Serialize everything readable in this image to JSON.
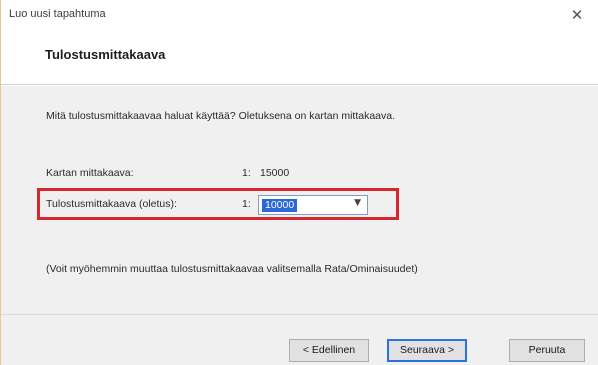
{
  "window": {
    "title": "Luo uusi tapahtuma",
    "close_glyph": "✕"
  },
  "header": {
    "title": "Tulostusmittakaava"
  },
  "main": {
    "intro": "Mitä tulostusmittakaavaa haluat käyttää? Oletuksena on kartan mittakaava.",
    "map_scale": {
      "label": "Kartan mittakaava:",
      "prefix": "1:",
      "value": "15000"
    },
    "print_scale": {
      "label": "Tulostusmittakaava (oletus):",
      "prefix": "1:",
      "value": "10000",
      "highlight_color": "#d8262f"
    },
    "note": "(Voit myöhemmin muuttaa tulostusmittakaavaa valitsemalla Rata/Ominaisuudet)"
  },
  "footer": {
    "back_label": "< Edellinen",
    "next_label": "Seuraava >",
    "cancel_label": "Peruuta"
  },
  "icons": {
    "close": "close-icon",
    "dropdown": "chevron-down-icon"
  },
  "colors": {
    "selection": "#2b68d8",
    "default_button_border": "#2d72d9"
  }
}
